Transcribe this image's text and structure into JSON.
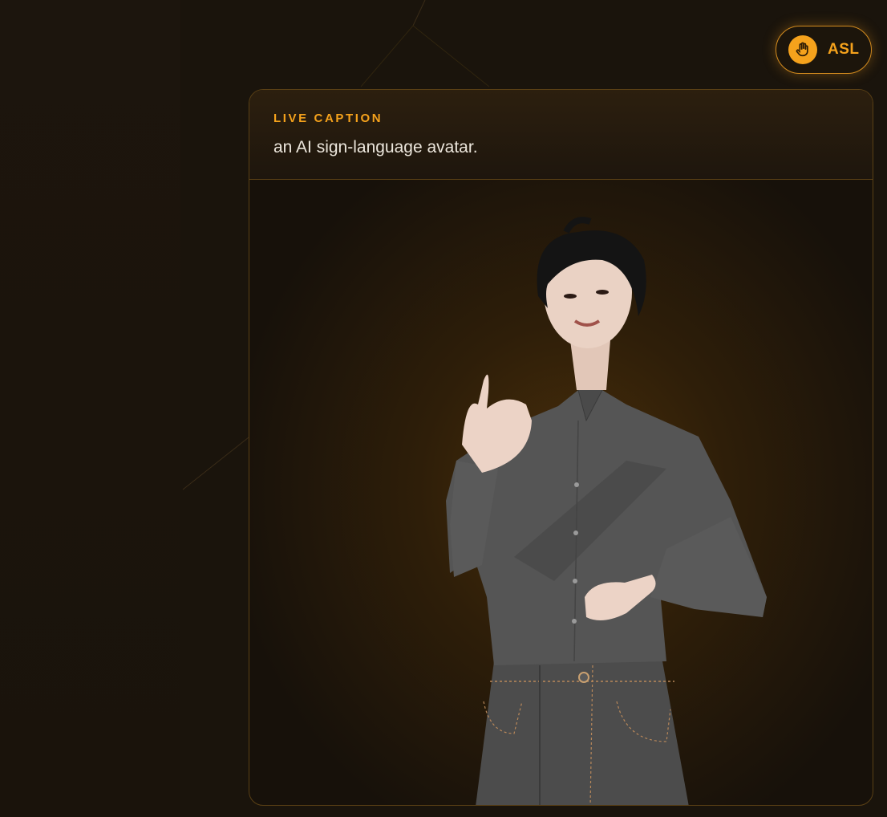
{
  "badge": {
    "label": "ASL",
    "icon": "hand-icon",
    "accent_color": "#f5a21c"
  },
  "caption": {
    "heading": "LIVE CAPTION",
    "text": "an AI sign-language avatar."
  },
  "avatar": {
    "description_icon": "signing-avatar"
  }
}
